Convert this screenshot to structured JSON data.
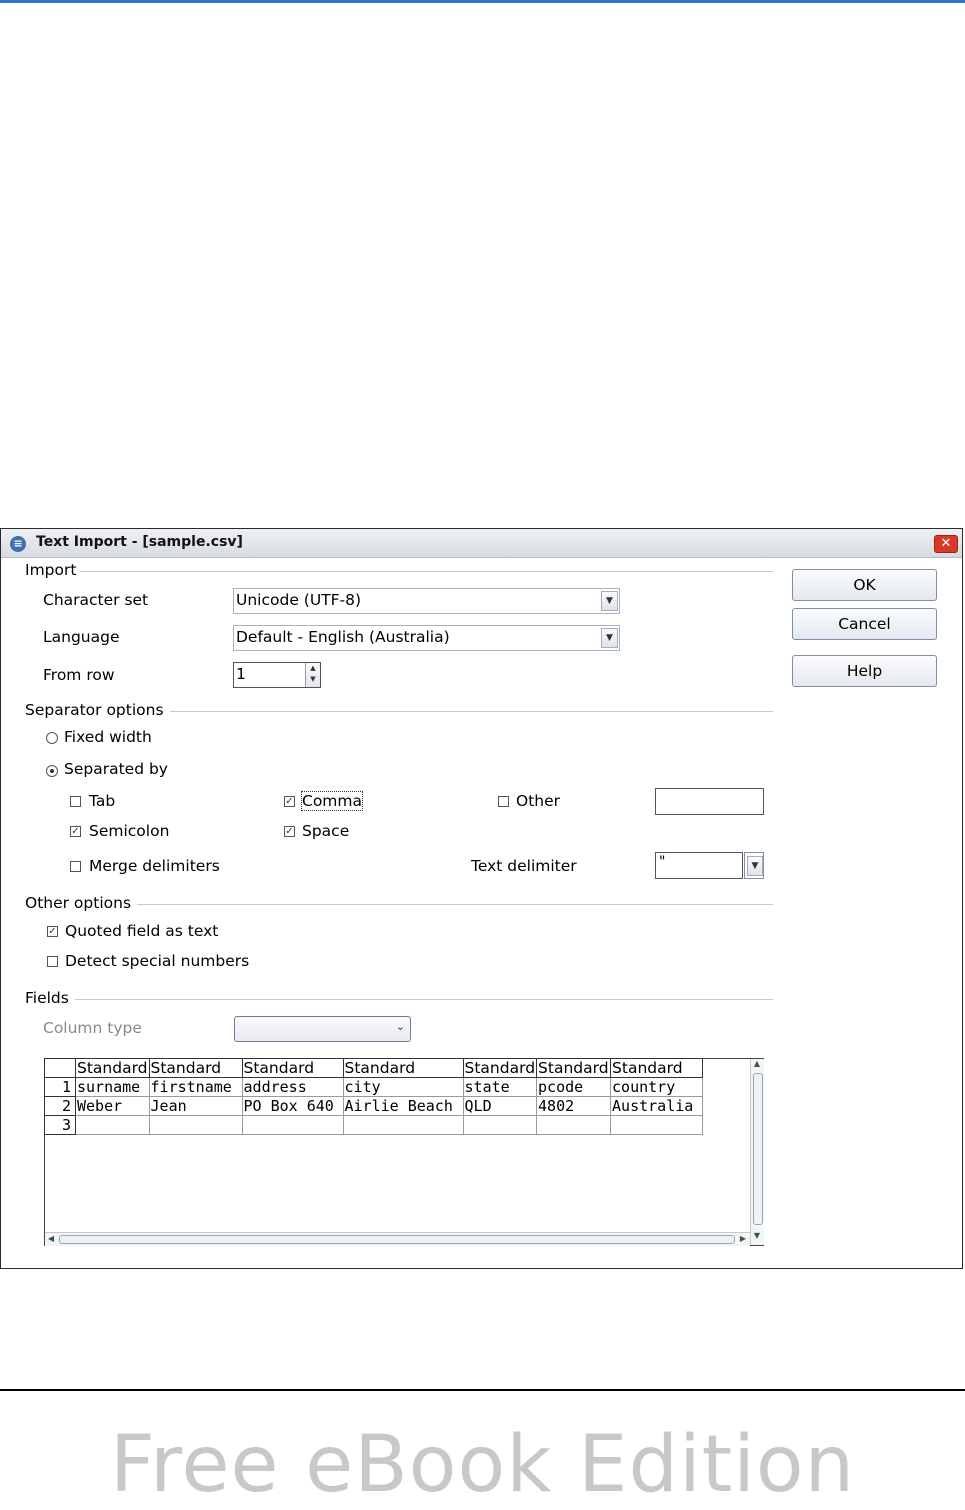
{
  "page": {
    "watermark": "Free eBook Edition"
  },
  "dialog": {
    "title": "Text Import - [sample.csv]",
    "close_glyph": "✕",
    "import": {
      "section_title": "Import",
      "character_set_label": "Character set",
      "character_set_value": "Unicode (UTF-8)",
      "language_label": "Language",
      "language_value": "Default - English (Australia)",
      "from_row_label": "From row",
      "from_row_value": "1"
    },
    "buttons": {
      "ok": "OK",
      "cancel": "Cancel",
      "help": "Help"
    },
    "separator": {
      "section_title": "Separator options",
      "fixed_width_label": "Fixed width",
      "fixed_width_selected": false,
      "separated_by_label": "Separated by",
      "separated_by_selected": true,
      "tab_label": "Tab",
      "tab_checked": false,
      "comma_label": "Comma",
      "comma_checked": true,
      "other_label": "Other",
      "other_checked": false,
      "other_value": "",
      "semicolon_label": "Semicolon",
      "semicolon_checked": true,
      "space_label": "Space",
      "space_checked": true,
      "merge_label": "Merge delimiters",
      "merge_checked": false,
      "text_delimiter_label": "Text delimiter",
      "text_delimiter_value": "\""
    },
    "other_options": {
      "section_title": "Other options",
      "quoted_label": "Quoted field as text",
      "quoted_checked": true,
      "detect_label": "Detect special numbers",
      "detect_checked": false
    },
    "fields": {
      "section_title": "Fields",
      "column_type_label": "Column type",
      "column_type_value": "",
      "column_headers": [
        "Standard",
        "Standard",
        "Standard",
        "Standard",
        "Standard",
        "Standard",
        "Standard"
      ],
      "rows": [
        {
          "num": "1",
          "cells": [
            "surname",
            "firstname",
            "address",
            "city",
            "state",
            "pcode",
            "country"
          ]
        },
        {
          "num": "2",
          "cells": [
            "Weber",
            "Jean",
            "PO Box 640",
            "Airlie Beach",
            "QLD",
            "4802",
            "Australia"
          ]
        },
        {
          "num": "3",
          "cells": [
            "",
            "",
            "",
            "",
            "",
            "",
            ""
          ]
        }
      ]
    }
  }
}
